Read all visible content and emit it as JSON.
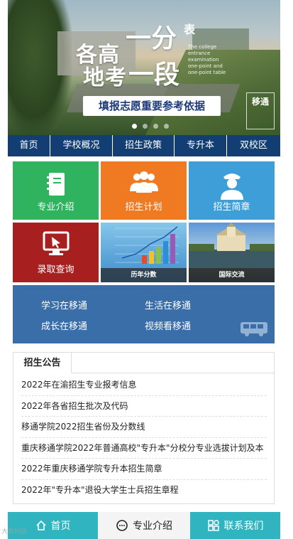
{
  "banner": {
    "headline_left_1": "各高",
    "headline_left_2": "地考",
    "headline_right_1": "一分",
    "headline_right_2": "一段",
    "headline_tag": "表",
    "english_text": "The college entrance examination one-point and one-point table",
    "slogan": "填报志愿重要参考依据",
    "logo_text": "移通",
    "slide_count": 4,
    "active_slide": 1
  },
  "nav": {
    "items": [
      {
        "label": "首页"
      },
      {
        "label": "学校概况"
      },
      {
        "label": "招生政策"
      },
      {
        "label": "专升本"
      },
      {
        "label": "双校区"
      }
    ]
  },
  "tiles": {
    "major_intro": "专业介绍",
    "enroll_plan": "招生计划",
    "enroll_brochure": "招生简章",
    "admission_query": "录取查询",
    "history_scores": "历年分数",
    "intl_exchange": "国际交流"
  },
  "life_panel": {
    "study": "学习在移通",
    "live": "生活在移通",
    "grow": "成长在移通",
    "video": "视频看移通"
  },
  "notice": {
    "tab_label": "招生公告",
    "items": [
      {
        "text": "2022年在渝招生专业报考信息"
      },
      {
        "text": "2022年各省招生批次及代码"
      },
      {
        "text": "移通学院2022招生省份及分数线"
      },
      {
        "text": "重庆移通学院2022年普通高校\"专升本\"分校分专业选拔计划及本"
      },
      {
        "text": "2022年重庆移通学院专升本招生简章"
      },
      {
        "text": "2022年\"专升本\"退役大学生士兵招生章程"
      }
    ]
  },
  "footer": {
    "home": "首页",
    "major": "专业介绍",
    "contact": "联系我们"
  },
  "watermark": "大数科技",
  "colors": {
    "nav_bg": "#123e74",
    "green": "#2fb35e",
    "orange": "#f07a22",
    "blue": "#3e9fd8",
    "red": "#a71f1f",
    "life_bg": "#3a6ea8",
    "footer_teal": "#2fb4c0"
  }
}
